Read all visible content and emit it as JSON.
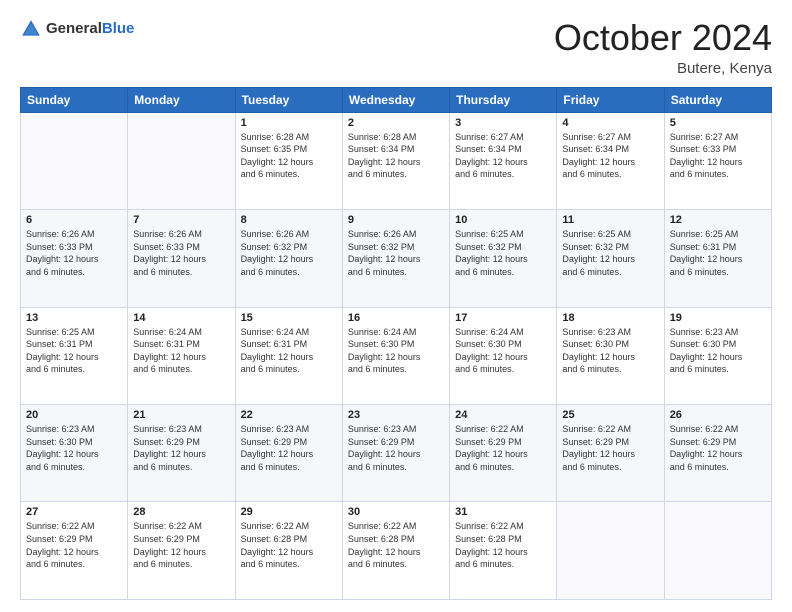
{
  "logo": {
    "general": "General",
    "blue": "Blue"
  },
  "header": {
    "month": "October 2024",
    "location": "Butere, Kenya"
  },
  "weekdays": [
    "Sunday",
    "Monday",
    "Tuesday",
    "Wednesday",
    "Thursday",
    "Friday",
    "Saturday"
  ],
  "weeks": [
    [
      {
        "day": "",
        "sunrise": "",
        "sunset": "",
        "daylight": ""
      },
      {
        "day": "",
        "sunrise": "",
        "sunset": "",
        "daylight": ""
      },
      {
        "day": "1",
        "sunrise": "Sunrise: 6:28 AM",
        "sunset": "Sunset: 6:35 PM",
        "daylight": "Daylight: 12 hours and 6 minutes."
      },
      {
        "day": "2",
        "sunrise": "Sunrise: 6:28 AM",
        "sunset": "Sunset: 6:34 PM",
        "daylight": "Daylight: 12 hours and 6 minutes."
      },
      {
        "day": "3",
        "sunrise": "Sunrise: 6:27 AM",
        "sunset": "Sunset: 6:34 PM",
        "daylight": "Daylight: 12 hours and 6 minutes."
      },
      {
        "day": "4",
        "sunrise": "Sunrise: 6:27 AM",
        "sunset": "Sunset: 6:34 PM",
        "daylight": "Daylight: 12 hours and 6 minutes."
      },
      {
        "day": "5",
        "sunrise": "Sunrise: 6:27 AM",
        "sunset": "Sunset: 6:33 PM",
        "daylight": "Daylight: 12 hours and 6 minutes."
      }
    ],
    [
      {
        "day": "6",
        "sunrise": "Sunrise: 6:26 AM",
        "sunset": "Sunset: 6:33 PM",
        "daylight": "Daylight: 12 hours and 6 minutes."
      },
      {
        "day": "7",
        "sunrise": "Sunrise: 6:26 AM",
        "sunset": "Sunset: 6:33 PM",
        "daylight": "Daylight: 12 hours and 6 minutes."
      },
      {
        "day": "8",
        "sunrise": "Sunrise: 6:26 AM",
        "sunset": "Sunset: 6:32 PM",
        "daylight": "Daylight: 12 hours and 6 minutes."
      },
      {
        "day": "9",
        "sunrise": "Sunrise: 6:26 AM",
        "sunset": "Sunset: 6:32 PM",
        "daylight": "Daylight: 12 hours and 6 minutes."
      },
      {
        "day": "10",
        "sunrise": "Sunrise: 6:25 AM",
        "sunset": "Sunset: 6:32 PM",
        "daylight": "Daylight: 12 hours and 6 minutes."
      },
      {
        "day": "11",
        "sunrise": "Sunrise: 6:25 AM",
        "sunset": "Sunset: 6:32 PM",
        "daylight": "Daylight: 12 hours and 6 minutes."
      },
      {
        "day": "12",
        "sunrise": "Sunrise: 6:25 AM",
        "sunset": "Sunset: 6:31 PM",
        "daylight": "Daylight: 12 hours and 6 minutes."
      }
    ],
    [
      {
        "day": "13",
        "sunrise": "Sunrise: 6:25 AM",
        "sunset": "Sunset: 6:31 PM",
        "daylight": "Daylight: 12 hours and 6 minutes."
      },
      {
        "day": "14",
        "sunrise": "Sunrise: 6:24 AM",
        "sunset": "Sunset: 6:31 PM",
        "daylight": "Daylight: 12 hours and 6 minutes."
      },
      {
        "day": "15",
        "sunrise": "Sunrise: 6:24 AM",
        "sunset": "Sunset: 6:31 PM",
        "daylight": "Daylight: 12 hours and 6 minutes."
      },
      {
        "day": "16",
        "sunrise": "Sunrise: 6:24 AM",
        "sunset": "Sunset: 6:30 PM",
        "daylight": "Daylight: 12 hours and 6 minutes."
      },
      {
        "day": "17",
        "sunrise": "Sunrise: 6:24 AM",
        "sunset": "Sunset: 6:30 PM",
        "daylight": "Daylight: 12 hours and 6 minutes."
      },
      {
        "day": "18",
        "sunrise": "Sunrise: 6:23 AM",
        "sunset": "Sunset: 6:30 PM",
        "daylight": "Daylight: 12 hours and 6 minutes."
      },
      {
        "day": "19",
        "sunrise": "Sunrise: 6:23 AM",
        "sunset": "Sunset: 6:30 PM",
        "daylight": "Daylight: 12 hours and 6 minutes."
      }
    ],
    [
      {
        "day": "20",
        "sunrise": "Sunrise: 6:23 AM",
        "sunset": "Sunset: 6:30 PM",
        "daylight": "Daylight: 12 hours and 6 minutes."
      },
      {
        "day": "21",
        "sunrise": "Sunrise: 6:23 AM",
        "sunset": "Sunset: 6:29 PM",
        "daylight": "Daylight: 12 hours and 6 minutes."
      },
      {
        "day": "22",
        "sunrise": "Sunrise: 6:23 AM",
        "sunset": "Sunset: 6:29 PM",
        "daylight": "Daylight: 12 hours and 6 minutes."
      },
      {
        "day": "23",
        "sunrise": "Sunrise: 6:23 AM",
        "sunset": "Sunset: 6:29 PM",
        "daylight": "Daylight: 12 hours and 6 minutes."
      },
      {
        "day": "24",
        "sunrise": "Sunrise: 6:22 AM",
        "sunset": "Sunset: 6:29 PM",
        "daylight": "Daylight: 12 hours and 6 minutes."
      },
      {
        "day": "25",
        "sunrise": "Sunrise: 6:22 AM",
        "sunset": "Sunset: 6:29 PM",
        "daylight": "Daylight: 12 hours and 6 minutes."
      },
      {
        "day": "26",
        "sunrise": "Sunrise: 6:22 AM",
        "sunset": "Sunset: 6:29 PM",
        "daylight": "Daylight: 12 hours and 6 minutes."
      }
    ],
    [
      {
        "day": "27",
        "sunrise": "Sunrise: 6:22 AM",
        "sunset": "Sunset: 6:29 PM",
        "daylight": "Daylight: 12 hours and 6 minutes."
      },
      {
        "day": "28",
        "sunrise": "Sunrise: 6:22 AM",
        "sunset": "Sunset: 6:29 PM",
        "daylight": "Daylight: 12 hours and 6 minutes."
      },
      {
        "day": "29",
        "sunrise": "Sunrise: 6:22 AM",
        "sunset": "Sunset: 6:28 PM",
        "daylight": "Daylight: 12 hours and 6 minutes."
      },
      {
        "day": "30",
        "sunrise": "Sunrise: 6:22 AM",
        "sunset": "Sunset: 6:28 PM",
        "daylight": "Daylight: 12 hours and 6 minutes."
      },
      {
        "day": "31",
        "sunrise": "Sunrise: 6:22 AM",
        "sunset": "Sunset: 6:28 PM",
        "daylight": "Daylight: 12 hours and 6 minutes."
      },
      {
        "day": "",
        "sunrise": "",
        "sunset": "",
        "daylight": ""
      },
      {
        "day": "",
        "sunrise": "",
        "sunset": "",
        "daylight": ""
      }
    ]
  ]
}
